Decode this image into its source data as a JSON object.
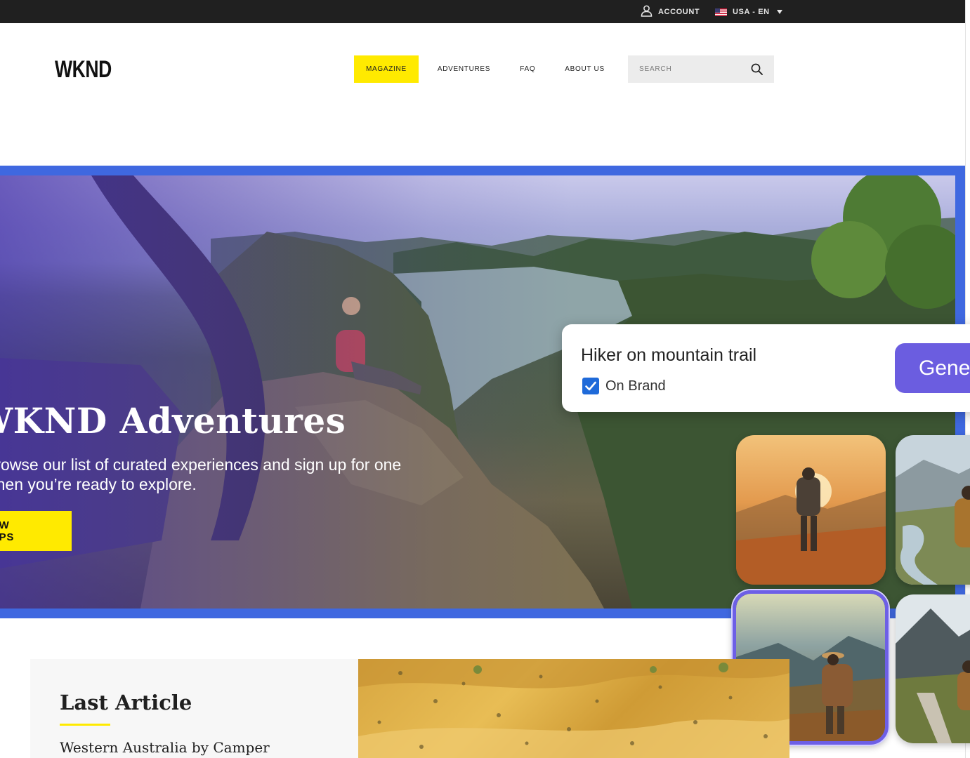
{
  "topbar": {
    "account_label": "ACCOUNT",
    "language_label": "USA - EN",
    "icons": {
      "account": "user-icon",
      "language": "us-flag-icon",
      "dropdown": "caret-down-icon"
    }
  },
  "header": {
    "logo": "WKND",
    "nav": {
      "magazine": "MAGAZINE",
      "adventures": "ADVENTURES",
      "faq": "FAQ",
      "about": "ABOUT US",
      "active": "MAGAZINE"
    },
    "search": {
      "placeholder": "SEARCH",
      "icon": "search-icon"
    }
  },
  "hero": {
    "title": "WKND Adventures",
    "description": "Browse our list of curated experiences and sign up for one when you’re ready to explore.",
    "button_label": "VIEW TRIPS"
  },
  "generate_panel": {
    "prompt": "Hiker on mountain trail",
    "on_brand_label": "On Brand",
    "on_brand_checked": true,
    "button_label": "Generate",
    "selected_variation": 3
  },
  "last_article": {
    "heading": "Last Article",
    "title": "Western Australia by Camper"
  },
  "colors": {
    "brand_yellow": "#ffea00",
    "topbar": "#202020",
    "hero_border": "#3f68e0",
    "generate_button": "#6b5de0",
    "checkbox": "#1f6ad9"
  }
}
